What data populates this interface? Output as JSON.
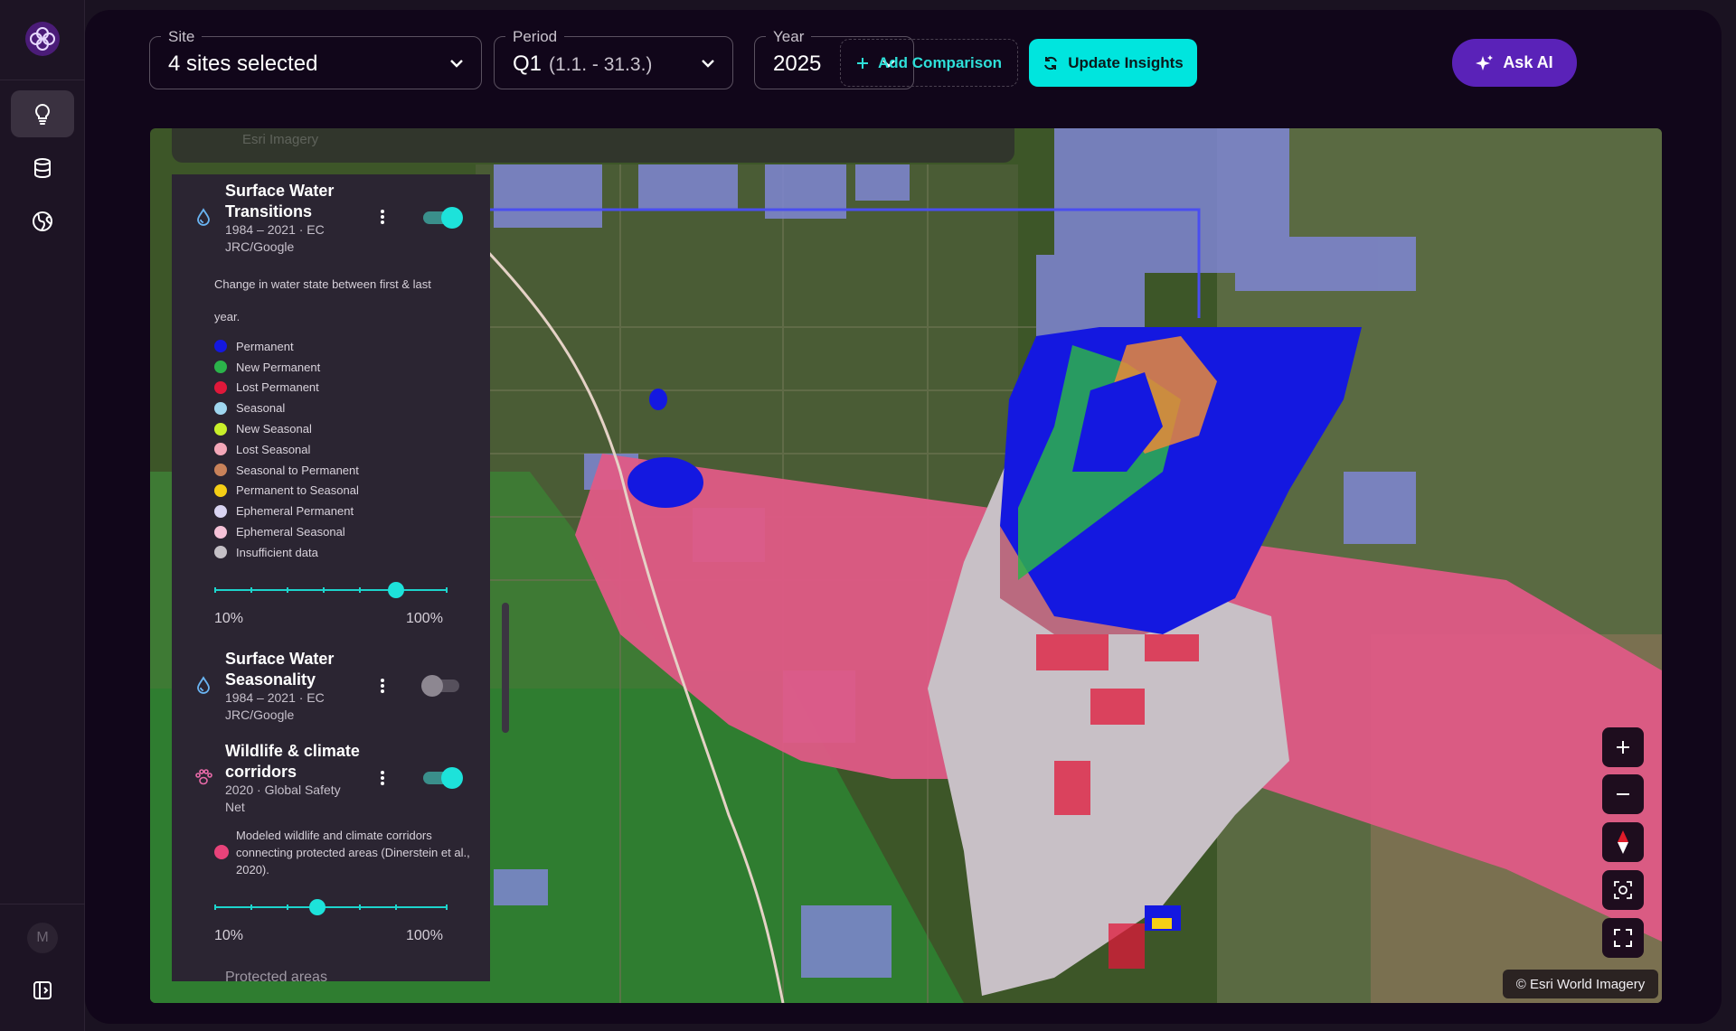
{
  "rail": {
    "avatar_initial": "M"
  },
  "filters": {
    "site": {
      "label": "Site",
      "value": "4 sites selected"
    },
    "period": {
      "label": "Period",
      "value": "Q1",
      "range": "(1.1. - 31.3.)"
    },
    "year": {
      "label": "Year",
      "value": "2025"
    }
  },
  "actions": {
    "add_comparison": "Add Comparison",
    "update_insights": "Update Insights",
    "ask_ai": "Ask AI"
  },
  "map_toolbar": {
    "basemap": "Esri Imagery"
  },
  "layers": [
    {
      "title": "Surface Water Transitions",
      "meta": "1984 – 2021 · EC JRC/Google",
      "enabled": true,
      "description": "Change in water state between first & last year.",
      "legend": [
        {
          "label": "Permanent",
          "color": "#1418e0"
        },
        {
          "label": "New Permanent",
          "color": "#2bb34a"
        },
        {
          "label": "Lost Permanent",
          "color": "#e0183a"
        },
        {
          "label": "Seasonal",
          "color": "#9fd6ef"
        },
        {
          "label": "New Seasonal",
          "color": "#c9ef2a"
        },
        {
          "label": "Lost Seasonal",
          "color": "#f4a7b8"
        },
        {
          "label": "Seasonal to Permanent",
          "color": "#c9825a"
        },
        {
          "label": "Permanent to Seasonal",
          "color": "#f5cf15"
        },
        {
          "label": "Ephemeral Permanent",
          "color": "#d9d4f2"
        },
        {
          "label": "Ephemeral Seasonal",
          "color": "#f6c2d8"
        },
        {
          "label": "Insufficient data",
          "color": "#c4c0c6"
        }
      ],
      "opacity": {
        "min_label": "10%",
        "max_label": "100%",
        "value": 0.78
      }
    },
    {
      "title": "Surface Water Seasonality",
      "meta": "1984 – 2021 · EC JRC/Google",
      "enabled": false
    },
    {
      "title": "Wildlife & climate corridors",
      "meta": "2020 · Global Safety Net",
      "enabled": true,
      "legend_color": "#e8437a",
      "legend_text": "Modeled wildlife and climate corridors connecting protected areas (Dinerstein et al., 2020).",
      "opacity": {
        "min_label": "10%",
        "max_label": "100%",
        "value": 0.44
      }
    },
    {
      "title": "Protected areas"
    }
  ],
  "map": {
    "attribution": "© Esri World Imagery"
  }
}
